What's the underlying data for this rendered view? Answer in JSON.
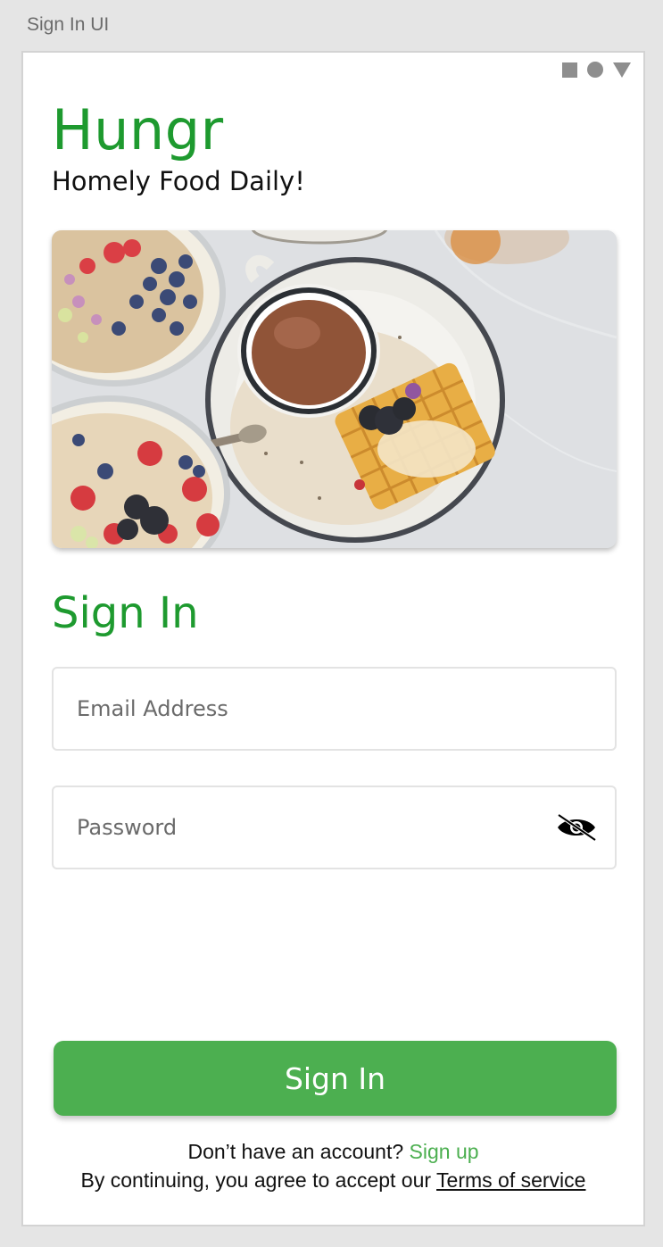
{
  "frame": {
    "title": "Sign In UI"
  },
  "status_bar": {
    "icons": [
      "square-icon",
      "circle-icon",
      "triangle-icon"
    ],
    "icon_color": "#8e8e8e"
  },
  "brand": {
    "name": "Hungr",
    "tagline": "Homely Food Daily!",
    "color": "#1e9a2f"
  },
  "hero": {
    "icon": "breakfast-food-photo"
  },
  "form": {
    "title": "Sign In",
    "email": {
      "placeholder": "Email Address",
      "value": ""
    },
    "password": {
      "placeholder": "Password",
      "value": "",
      "toggle_icon": "eye-slash-icon"
    },
    "submit_label": "Sign In",
    "submit_color": "#4caf50"
  },
  "footer": {
    "no_account_text": "Don’t have an account?",
    "signup_link": "Sign up",
    "terms_prefix": "By continuing, you agree to accept our",
    "terms_link": "Terms of service"
  }
}
